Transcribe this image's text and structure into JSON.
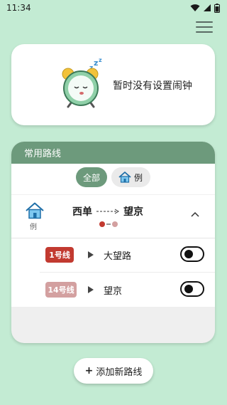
{
  "status_bar": {
    "time": "11:34"
  },
  "alarm": {
    "empty_text": "暂时没有设置闹钟"
  },
  "routes": {
    "header": "常用路线",
    "filters": {
      "all": "全部",
      "example": "例"
    },
    "route": {
      "from": "西单",
      "to": "望京",
      "home_label": "例",
      "dot_colors": [
        "#c23a30",
        "#d3a0a0"
      ],
      "lines": [
        {
          "badge": "1号线",
          "color": "#c23a30",
          "station": "大望路",
          "enabled": false
        },
        {
          "badge": "14号线",
          "color": "#d3a0a0",
          "station": "望京",
          "enabled": false
        }
      ]
    }
  },
  "add_route": {
    "plus": "+",
    "label": "添加新路线"
  },
  "icons": {
    "wifi": "wifi-icon",
    "signal": "signal-icon",
    "battery": "battery-icon",
    "menu": "menu-icon",
    "alarm_clock": "sleeping-alarm-clock-icon",
    "home": "home-icon",
    "chevron_up": "chevron-up-icon",
    "play": "play-icon"
  }
}
